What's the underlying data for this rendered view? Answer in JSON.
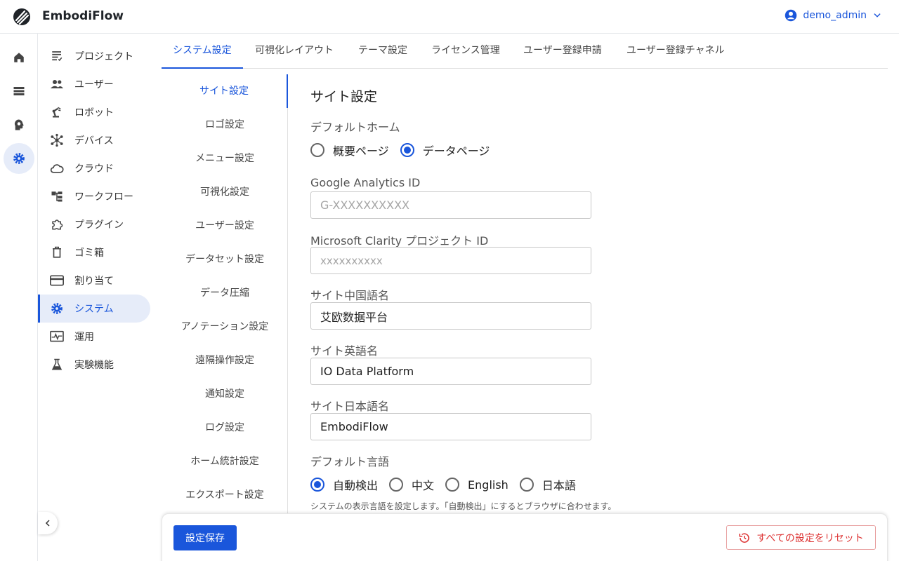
{
  "app": {
    "brand": "EmbodiFlow"
  },
  "user": {
    "name": "demo_admin"
  },
  "nav": {
    "items": [
      {
        "label": "プロジェクト",
        "icon": "project-list-icon"
      },
      {
        "label": "ユーザー",
        "icon": "users-icon"
      },
      {
        "label": "ロボット",
        "icon": "robot-arm-icon"
      },
      {
        "label": "デバイス",
        "icon": "device-hub-icon"
      },
      {
        "label": "クラウド",
        "icon": "cloud-icon"
      },
      {
        "label": "ワークフロー",
        "icon": "workflow-icon"
      },
      {
        "label": "プラグイン",
        "icon": "plugin-icon"
      },
      {
        "label": "ゴミ箱",
        "icon": "trash-icon"
      },
      {
        "label": "割り当て",
        "icon": "card-icon"
      },
      {
        "label": "システム",
        "icon": "gear-icon",
        "active": true
      },
      {
        "label": "運用",
        "icon": "monitor-icon"
      },
      {
        "label": "実験機能",
        "icon": "flask-icon"
      }
    ]
  },
  "tabs": [
    {
      "label": "システム設定",
      "active": true
    },
    {
      "label": "可視化レイアウト"
    },
    {
      "label": "テーマ設定"
    },
    {
      "label": "ライセンス管理"
    },
    {
      "label": "ユーザー登録申請"
    },
    {
      "label": "ユーザー登録チャネル"
    }
  ],
  "submenu": [
    {
      "label": "サイト設定",
      "active": true
    },
    {
      "label": "ロゴ設定"
    },
    {
      "label": "メニュー設定"
    },
    {
      "label": "可視化設定"
    },
    {
      "label": "ユーザー設定"
    },
    {
      "label": "データセット設定"
    },
    {
      "label": "データ圧縮"
    },
    {
      "label": "アノテーション設定"
    },
    {
      "label": "遠隔操作設定"
    },
    {
      "label": "通知設定"
    },
    {
      "label": "ログ設定"
    },
    {
      "label": "ホーム統計設定"
    },
    {
      "label": "エクスポート設定"
    }
  ],
  "form": {
    "title": "サイト設定",
    "default_home": {
      "label": "デフォルトホーム",
      "options": [
        "概要ページ",
        "データページ"
      ],
      "selected": "データページ"
    },
    "ga": {
      "label": "Google Analytics ID",
      "value": "",
      "placeholder": "G-XXXXXXXXXX"
    },
    "clarity": {
      "label": "Microsoft Clarity プロジェクト ID",
      "value": "",
      "placeholder": "xxxxxxxxxx"
    },
    "name_zh": {
      "label": "サイト中国語名",
      "value": "艾欧数据平台"
    },
    "name_en": {
      "label": "サイト英語名",
      "value": "IO Data Platform"
    },
    "name_ja": {
      "label": "サイト日本語名",
      "value": "EmbodiFlow"
    },
    "default_lang": {
      "label": "デフォルト言語",
      "options": [
        "自動検出",
        "中文",
        "English",
        "日本語"
      ],
      "selected": "自動検出",
      "help": "システムの表示言語を設定します。「自動検出」にするとブラウザに合わせます。"
    }
  },
  "footer": {
    "save_label": "設定保存",
    "reset_label": "すべての設定をリセット"
  },
  "colors": {
    "accent": "#1a56db",
    "danger": "#dd3333",
    "active_bg": "#e6ecf9"
  }
}
